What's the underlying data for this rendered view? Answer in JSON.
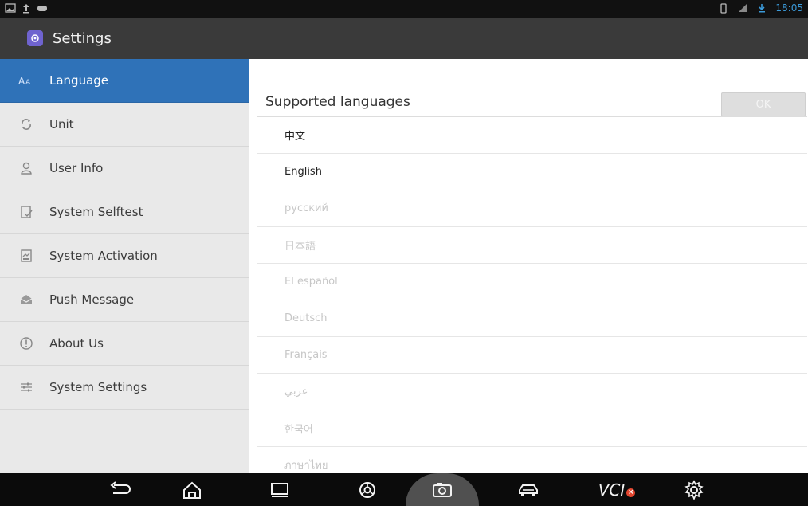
{
  "status_bar": {
    "time": "18:05"
  },
  "title_bar": {
    "app_title": "Settings",
    "icon": "settings-app-icon"
  },
  "sidebar": {
    "items": [
      {
        "label": "Language",
        "icon": "language-icon",
        "active": true
      },
      {
        "label": "Unit",
        "icon": "unit-icon",
        "active": false
      },
      {
        "label": "User Info",
        "icon": "user-icon",
        "active": false
      },
      {
        "label": "System Selftest",
        "icon": "selftest-icon",
        "active": false
      },
      {
        "label": "System Activation",
        "icon": "activation-icon",
        "active": false
      },
      {
        "label": "Push Message",
        "icon": "message-icon",
        "active": false
      },
      {
        "label": "About Us",
        "icon": "info-icon",
        "active": false
      },
      {
        "label": "System Settings",
        "icon": "sliders-icon",
        "active": false
      }
    ]
  },
  "content": {
    "header": "Supported languages",
    "ok_label": "OK",
    "languages": [
      {
        "label": "中文",
        "enabled": true
      },
      {
        "label": "English",
        "enabled": true
      },
      {
        "label": "русский",
        "enabled": false
      },
      {
        "label": "日本語",
        "enabled": false
      },
      {
        "label": "El español",
        "enabled": false
      },
      {
        "label": "Deutsch",
        "enabled": false
      },
      {
        "label": "Français",
        "enabled": false
      },
      {
        "label": "عربي",
        "enabled": false
      },
      {
        "label": "한국어",
        "enabled": false
      },
      {
        "label": "ภาษาไทย",
        "enabled": false
      }
    ]
  },
  "nav_bar": {
    "vci_label": "VCI",
    "items": [
      "back-icon",
      "home-icon",
      "recent-apps-icon",
      "browser-icon",
      "screenshot-icon",
      "car-icon",
      "vci-status",
      "settings-gear-icon"
    ]
  }
}
